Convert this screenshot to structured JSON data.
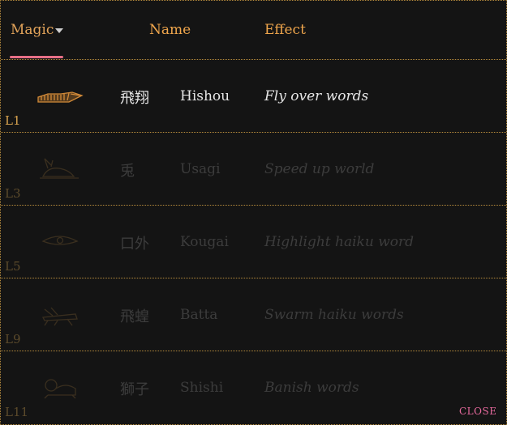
{
  "header": {
    "magic": "Magic",
    "name": "Name",
    "effect": "Effect"
  },
  "rows": [
    {
      "kanji": "飛翔",
      "name": "Hishou",
      "effect": "Fly over words",
      "level": "L1",
      "icon": "wing-icon",
      "locked": false
    },
    {
      "kanji": "兎",
      "name": "Usagi",
      "effect": "Speed up world",
      "level": "L3",
      "icon": "rabbit-icon",
      "locked": true
    },
    {
      "kanji": "口外",
      "name": "Kougai",
      "effect": "Highlight haiku word",
      "level": "L5",
      "icon": "eye-icon",
      "locked": true
    },
    {
      "kanji": "飛蝗",
      "name": "Batta",
      "effect": "Swarm haiku words",
      "level": "L9",
      "icon": "grasshopper-icon",
      "locked": true
    },
    {
      "kanji": "獅子",
      "name": "Shishi",
      "effect": "Banish words",
      "level": "L11",
      "icon": "lion-icon",
      "locked": true
    }
  ],
  "close_label": "CLOSE",
  "colors": {
    "accent": "#e76f86",
    "header": "#f0a64c",
    "level": "#d8a34f",
    "border": "#b58a3c"
  }
}
